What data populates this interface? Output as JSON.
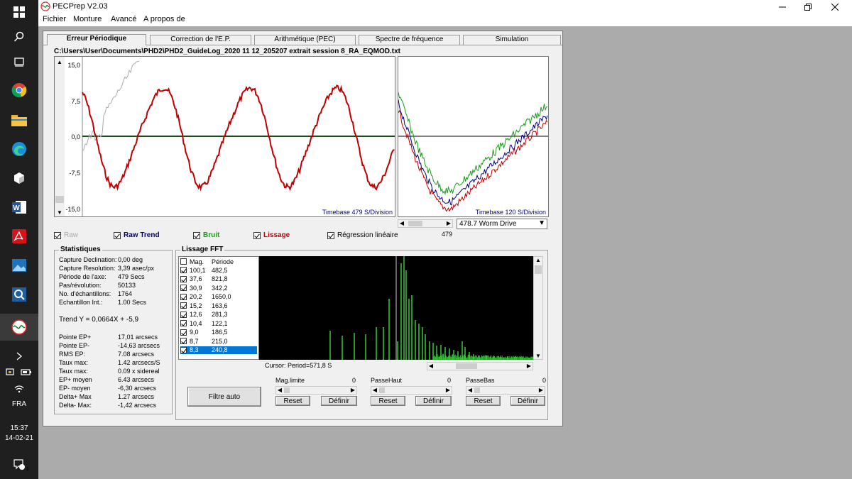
{
  "taskbar": {
    "language": "FRA",
    "time": "15:37",
    "date": "14-02-21",
    "notification_count": "1"
  },
  "window": {
    "title": "PECPrep V2.03",
    "menu": [
      "Fichier",
      "Monture",
      "Avancé",
      "A propos de"
    ]
  },
  "tabs": [
    "Erreur Périodique",
    "Correction de l'E.P.",
    "Arithmétique (PEC)",
    "Spectre de fréquence",
    "Simulation"
  ],
  "file_path": "C:\\Users\\User\\Documents\\PHD2\\PHD2_GuideLog_2020 11 12_205207  extrait session 8_RA_EQMOD.txt",
  "main_chart": {
    "y_ticks": [
      "15,0",
      "7,5",
      "0,0",
      "-7,5",
      "-15,0"
    ],
    "timebase": "Timebase 479 S/Division"
  },
  "side_chart": {
    "timebase": "Timebase 120 S/Division"
  },
  "options": {
    "raw": "Raw",
    "raw_trend": "Raw Trend",
    "bruit": "Bruit",
    "lissage": "Lissage",
    "regression": "Régression linéaire",
    "period_value": "479",
    "worm_select": "478.7 Worm Drive"
  },
  "stats": {
    "title": "Statistiques",
    "rows": [
      {
        "label": "Capture Declination:",
        "value": "0,00 deg"
      },
      {
        "label": "Capture Resolution:",
        "value": "3,39 asec/px"
      },
      {
        "label": "Période de l'axe:",
        "value": "479 Secs"
      },
      {
        "label": "Pas/révolution:",
        "value": "50133"
      },
      {
        "label": "No. d'échantillons:",
        "value": "1764"
      },
      {
        "label": "Echantillon Int.:",
        "value": "1.00 Secs"
      }
    ],
    "trend": "Trend  Y = 0,0664X + -5,9",
    "rows2": [
      {
        "label": "Pointe EP+",
        "value": "17,01 arcsecs"
      },
      {
        "label": "Pointe EP-",
        "value": "-14,63 arcsecs"
      },
      {
        "label": "RMS EP:",
        "value": "7.08 arcsecs"
      },
      {
        "label": "Taux max:",
        "value": "1.42 arcsecs/S"
      },
      {
        "label": "Taux max:",
        "value": "0.09 x sidereal"
      },
      {
        "label": "EP+ moyen",
        "value": "6.43 arcsecs"
      },
      {
        "label": "EP- moyen",
        "value": "-6,30 arcsecs"
      },
      {
        "label": "Delta+ Max",
        "value": "1.27 arcsecs"
      },
      {
        "label": "Delta- Max:",
        "value": "-1,42 arcsecs"
      }
    ]
  },
  "fft": {
    "title": "Lissage FFT",
    "col_mag": "Mag.",
    "col_period": "Période",
    "rows": [
      {
        "mag": "100,1",
        "period": "482,5",
        "checked": true
      },
      {
        "mag": "37,6",
        "period": "821,8",
        "checked": true
      },
      {
        "mag": "30,9",
        "period": "342,2",
        "checked": true
      },
      {
        "mag": "20,2",
        "period": "1650,0",
        "checked": true
      },
      {
        "mag": "15,2",
        "period": "163,6",
        "checked": true
      },
      {
        "mag": "12,6",
        "period": "281,3",
        "checked": true
      },
      {
        "mag": "10,4",
        "period": "122,1",
        "checked": true
      },
      {
        "mag": "9,0",
        "period": "186,5",
        "checked": true
      },
      {
        "mag": "8,7",
        "period": "215,0",
        "checked": true
      },
      {
        "mag": "8,3",
        "period": "240,8",
        "checked": true
      }
    ],
    "cursor": "Cursor: Period=571,8 S",
    "filtre_auto": "Filtre auto",
    "mag_limite": "Mag.limite",
    "passe_haut": "PasseHaut",
    "passe_bas": "PasseBas",
    "zero": "0",
    "reset": "Reset",
    "definir": "Définir"
  },
  "colors": {
    "raw": "#aaaaaa",
    "lissage": "#c00000",
    "zero_line": "#1a4d1a",
    "raw_trend_blue": "#00007a",
    "bruit_green": "#1a9a1a",
    "fft_bar": "#33cc33"
  }
}
